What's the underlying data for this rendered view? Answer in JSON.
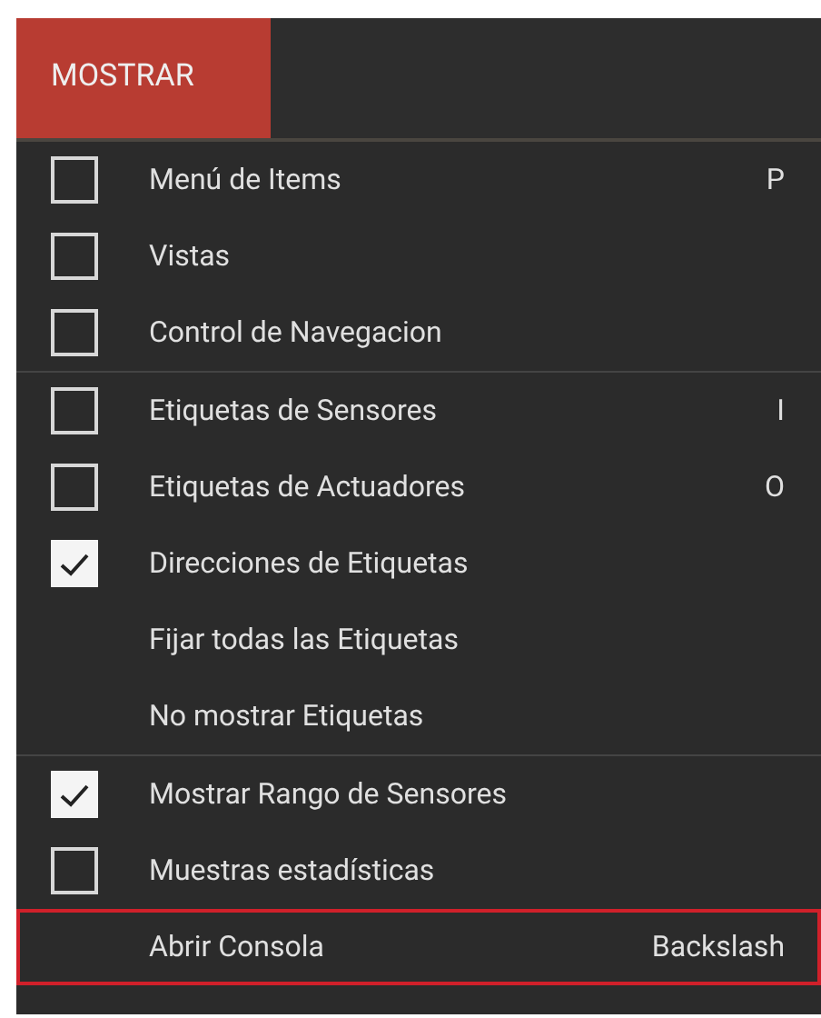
{
  "menu": {
    "title": "MOSTRAR",
    "selected": true
  },
  "sections": [
    {
      "items": [
        {
          "kind": "checkbox",
          "label": "Menú de Items",
          "checked": false,
          "shortcut": "P",
          "selected": false
        },
        {
          "kind": "checkbox",
          "label": "Vistas",
          "checked": false,
          "selected": false
        },
        {
          "kind": "checkbox",
          "label": "Control de Navegacion",
          "checked": false,
          "selected": false
        }
      ]
    },
    {
      "items": [
        {
          "kind": "checkbox",
          "label": "Etiquetas de Sensores",
          "checked": false,
          "shortcut": "I",
          "selected": false
        },
        {
          "kind": "checkbox",
          "label": "Etiquetas de Actuadores",
          "checked": false,
          "shortcut": "O",
          "selected": false
        },
        {
          "kind": "checkbox",
          "label": "Direcciones de Etiquetas",
          "checked": true,
          "selected": false
        },
        {
          "kind": "action",
          "label": "Fijar todas las Etiquetas",
          "selected": false
        },
        {
          "kind": "action",
          "label": "No mostrar Etiquetas",
          "selected": false
        }
      ]
    },
    {
      "items": [
        {
          "kind": "checkbox",
          "label": "Mostrar Rango de Sensores",
          "checked": true,
          "selected": false
        },
        {
          "kind": "checkbox",
          "label": "Muestras estadísticas",
          "checked": false,
          "selected": false
        },
        {
          "kind": "action",
          "label": "Abrir Consola",
          "shortcut": "Backslash",
          "selected": true
        }
      ]
    }
  ]
}
